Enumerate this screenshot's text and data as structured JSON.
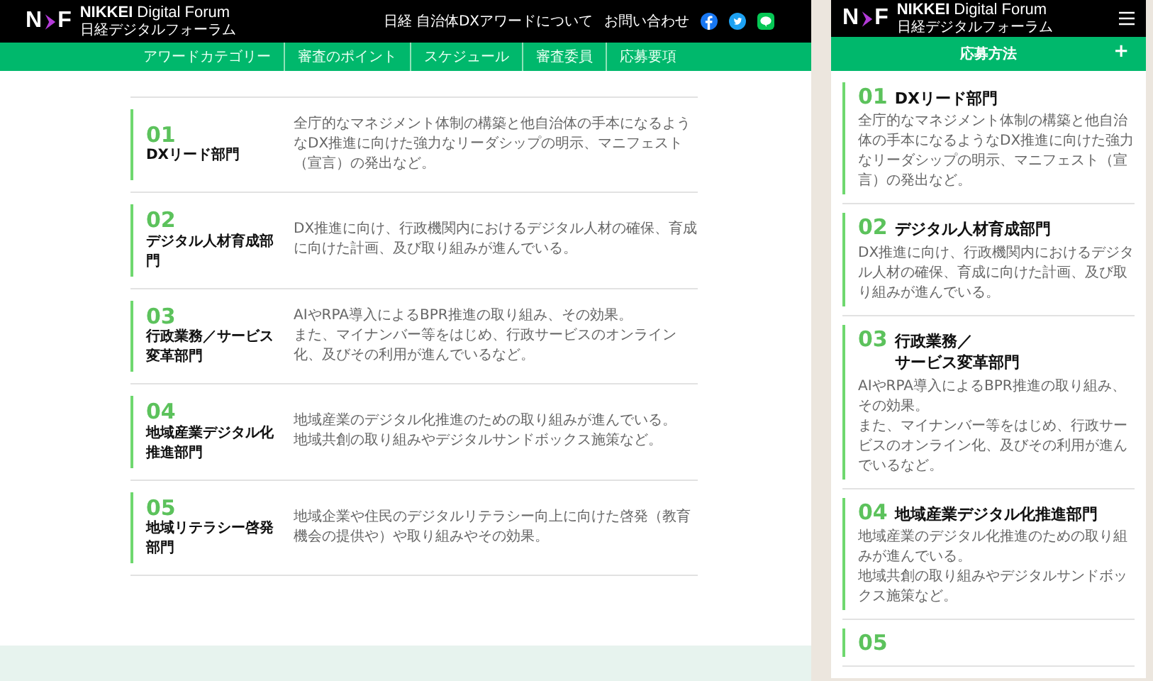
{
  "desktop": {
    "logo": {
      "mark_left": "N",
      "mark_right": "F",
      "name_bold": "NIKKEI",
      "name": "Digital Forum",
      "sub": "日経デジタルフォーラム"
    },
    "header_links": [
      "日経 自治体DXアワードについて",
      "お問い合わせ"
    ],
    "nav": [
      "アワードカテゴリー",
      "審査のポイント",
      "スケジュール",
      "審査委員",
      "応募要項"
    ],
    "categories": [
      {
        "number": "01",
        "title_lines": [
          "DXリード部門"
        ],
        "description_lines": [
          "全庁的なマネジメント体制の構築と他自治体の手本になるようなDX推進に向けた強力なリーダシップの明示、マニフェスト（宣言）の発出など。"
        ]
      },
      {
        "number": "02",
        "title_lines": [
          "デジタル人材育成部門"
        ],
        "description_lines": [
          "DX推進に向け、行政機関内におけるデジタル人材の確保、育成に向けた計画、及び取り組みが進んでいる。"
        ]
      },
      {
        "number": "03",
        "title_lines": [
          "行政業務／サービス変革部門"
        ],
        "description_lines": [
          "AIやRPA導入によるBPR推進の取り組み、その効果。",
          "また、マイナンバー等をはじめ、行政サービスのオンライン化、及びその利用が進んでいるなど。"
        ]
      },
      {
        "number": "04",
        "title_lines": [
          "地域産業デジタル化推進部門"
        ],
        "description_lines": [
          "地域産業のデジタル化推進のための取り組みが進んでいる。",
          "地域共創の取り組みやデジタルサンドボックス施策など。"
        ]
      },
      {
        "number": "05",
        "title_lines": [
          "地域リテラシー啓発部門"
        ],
        "description_lines": [
          "地域企業や住民のデジタルリテラシー向上に向けた啓発（教育機会の提供や）や取り組みやその効果。"
        ]
      }
    ]
  },
  "mobile": {
    "logo": {
      "mark_left": "N",
      "mark_right": "F",
      "name_bold": "NIKKEI",
      "name": "Digital Forum",
      "sub": "日経デジタルフォーラム"
    },
    "section_title": "応募方法",
    "expand_symbol": "+",
    "categories": [
      {
        "number": "01",
        "title_lines": [
          "DXリード部門"
        ],
        "description_lines": [
          "全庁的なマネジメント体制の構築と他自治体の手本になるようなDX推進に向けた強力なリーダシップの明示、マニフェスト（宣言）の発出など。"
        ]
      },
      {
        "number": "02",
        "title_lines": [
          "デジタル人材育成部門"
        ],
        "description_lines": [
          "DX推進に向け、行政機関内におけるデジタル人材の確保、育成に向けた計画、及び取り組みが進んでいる。"
        ]
      },
      {
        "number": "03",
        "title_lines": [
          "行政業務／",
          "サービス変革部門"
        ],
        "description_lines": [
          "AIやRPA導入によるBPR推進の取り組み、その効果。",
          "また、マイナンバー等をはじめ、行政サービスのオンライン化、及びその利用が進んでいるなど。"
        ]
      },
      {
        "number": "04",
        "title_lines": [
          "地域産業デジタル化推進部門"
        ],
        "description_lines": [
          "地域産業のデジタル化推進のための取り組みが進んでいる。",
          "地域共創の取り組みやデジタルサンドボックス施策など。"
        ]
      },
      {
        "number": "05"
      }
    ]
  }
}
